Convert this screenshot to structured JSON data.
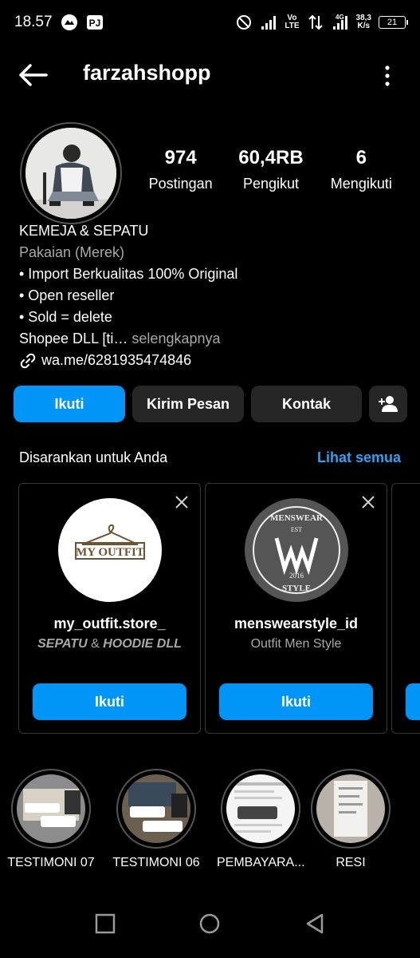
{
  "status_bar": {
    "time": "18.57",
    "volte": "Vo\nLTE",
    "network": "4G",
    "speed_value": "38,3",
    "speed_unit": "K/s",
    "battery": "21"
  },
  "header": {
    "username": "farzahshopp"
  },
  "profile": {
    "stats": [
      {
        "value": "974",
        "label": "Postingan"
      },
      {
        "value": "60,4RB",
        "label": "Pengikut"
      },
      {
        "value": "6",
        "label": "Mengikuti"
      }
    ],
    "bio": {
      "name": "KEMEJA & SEPATU",
      "category": "Pakaian (Merek)",
      "lines": [
        "• Import Berkualitas 100% Original",
        "• Open reseller",
        "• Sold = delete"
      ],
      "truncated": "Shopee DLL [ti… ",
      "more": "selengkapnya",
      "link": "wa.me/6281935474846"
    }
  },
  "actions": {
    "follow": "Ikuti",
    "message": "Kirim Pesan",
    "contact": "Kontak"
  },
  "suggestions": {
    "title": "Disarankan untuk Anda",
    "see_all": "Lihat semua",
    "cards": [
      {
        "name": "my_outfit.store_",
        "sub_a": "SEPATU",
        "sub_b": " & ",
        "sub_c": "HOODIE DLL",
        "logo_text": "MY OUTFIT",
        "button": "Ikuti"
      },
      {
        "name": "menswearstyle_id",
        "sub": "Outfit Men Style",
        "logo_top": "MENSWEAR",
        "logo_est": "EST",
        "logo_year": "2016",
        "logo_bottom": "STYLE",
        "button": "Ikuti"
      }
    ]
  },
  "highlights": [
    {
      "label": "TESTIMONI 07"
    },
    {
      "label": "TESTIMONI 06"
    },
    {
      "label": "PEMBAYARA..."
    },
    {
      "label": "RESI"
    }
  ],
  "colors": {
    "accent": "#0095f6",
    "link": "#2aa1f4",
    "button_dark": "#262626",
    "secondary_text": "#a8a8a8"
  }
}
